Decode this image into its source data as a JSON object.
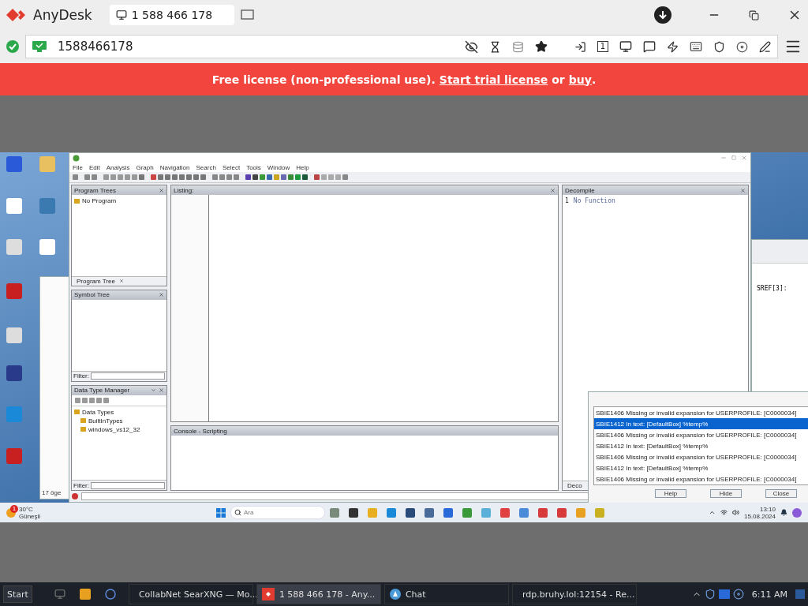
{
  "anydesk": {
    "app_name": "AnyDesk",
    "tab_label": "1 588 466 178",
    "address": "1588466178",
    "display_number": "1",
    "banner": {
      "prefix": "Free license (non-professional use).",
      "trial_link": "Start trial license",
      "middle": "or",
      "buy_link": "buy",
      "suffix": "."
    }
  },
  "remote": {
    "ghidra": {
      "menu": [
        "File",
        "Edit",
        "Analysis",
        "Graph",
        "Navigation",
        "Search",
        "Select",
        "Tools",
        "Window",
        "Help"
      ],
      "program_trees": {
        "title": "Program Trees",
        "items": [
          {
            "label": "No Program"
          }
        ],
        "tab": "Program Tree"
      },
      "symbol_tree": {
        "title": "Symbol Tree",
        "filter_label": "Filter:"
      },
      "data_type_manager": {
        "title": "Data Type Manager",
        "tree": [
          {
            "label": "Data Types",
            "children": [
              {
                "label": "BuiltInTypes"
              },
              {
                "label": "windows_vs12_32"
              }
            ]
          }
        ],
        "filter_label": "Filter:"
      },
      "listing": {
        "title": "Listing:"
      },
      "console": {
        "title": "Console - Scripting"
      },
      "decompile": {
        "title": "Decompile",
        "line": "1",
        "text": "No Function",
        "tab": "Deco"
      }
    },
    "explorer": {
      "status": "17 öge"
    },
    "back_window": {
      "label": "SREF[3]:"
    },
    "dialog": {
      "messages": [
        {
          "text": "SBIE1406 Missing or invalid expansion for USERPROFILE:  [C0000034]",
          "selected": false
        },
        {
          "text": "SBIE1412 In text: [DefaultBox] %temp%",
          "selected": true
        },
        {
          "text": "SBIE1406 Missing or invalid expansion for USERPROFILE:  [C0000034]",
          "selected": false
        },
        {
          "text": "SBIE1412 In text: [DefaultBox] %temp%",
          "selected": false
        },
        {
          "text": "SBIE1406 Missing or invalid expansion for USERPROFILE:  [C0000034]",
          "selected": false
        },
        {
          "text": "SBIE1412 In text: [DefaultBox] %temp%",
          "selected": false
        },
        {
          "text": "SBIE1406 Missing or invalid expansion for USERPROFILE:  [C0000034]",
          "selected": false
        }
      ],
      "buttons": [
        "Help",
        "Hide",
        "Close"
      ]
    },
    "taskbar": {
      "badge": "1",
      "temperature": "30°C",
      "weather": "Güneşli",
      "search_placeholder": "Ara",
      "time": "13:10",
      "date": "15.08.2024"
    }
  },
  "host_taskbar": {
    "start": "Start",
    "windows": [
      {
        "label": "CollabNet SearXNG — Mo...",
        "kind": "browser",
        "selected": false
      },
      {
        "label": "1 588 466 178 - Any...",
        "kind": "anydesk",
        "selected": true
      },
      {
        "label": "Chat",
        "kind": "chat",
        "selected": false
      },
      {
        "label": "rdp.bruhy.lol:12154 - Re...",
        "kind": "rdp",
        "selected": false
      }
    ],
    "clock": "6:11 AM"
  }
}
